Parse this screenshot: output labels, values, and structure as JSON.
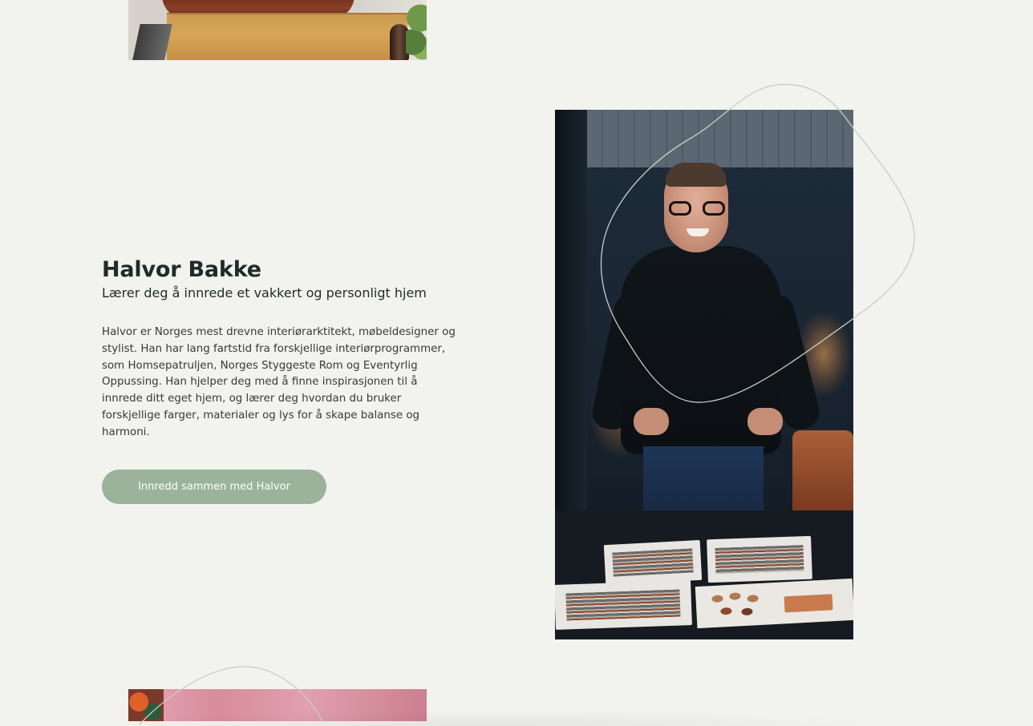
{
  "profile": {
    "name": "Halvor Bakke",
    "tagline": "Lærer deg å innrede et vakkert og personligt hjem",
    "bio": "Halvor er Norges mest drevne interiørarktitekt, møbeldesigner og stylist. Han har lang fartstid fra forskjellige interiørprogrammer, som Homsepatruljen, Norges Styggeste Rom og Eventyrlig Oppussing. Han hjelper deg med å finne inspirasjonen til å innrede ditt eget hjem, og lærer deg hvordan du bruker forskjellige farger, materialer og lys for å skape balanse og harmoni.",
    "cta_label": "Innredd sammen med Halvor"
  },
  "colors": {
    "background": "#f2f2ee",
    "heading": "#1f2b2b",
    "body_text": "#333b3b",
    "button_bg": "#9bb39a",
    "button_text": "#ffffff",
    "squiggle_stroke": "#c9d2c4"
  },
  "images": {
    "top": "interior-photo-cropped",
    "portrait": "halvor-portrait-photo",
    "bottom": "pink-interior-photo-cropped"
  }
}
